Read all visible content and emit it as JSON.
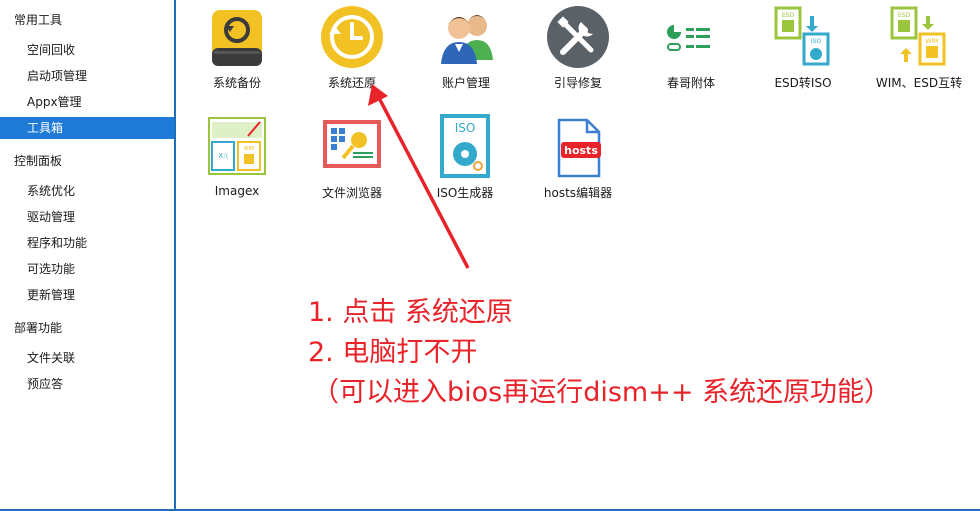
{
  "sidebar": {
    "groups": [
      {
        "title": "常用工具",
        "items": [
          "空间回收",
          "启动项管理",
          "Appx管理",
          "工具箱"
        ]
      },
      {
        "title": "控制面板",
        "items": [
          "系统优化",
          "驱动管理",
          "程序和功能",
          "可选功能",
          "更新管理"
        ]
      },
      {
        "title": "部署功能",
        "items": [
          "文件关联",
          "预应答"
        ]
      }
    ],
    "selected_item": "工具箱"
  },
  "tools": [
    {
      "label": "系统备份",
      "icon": "backup-drive-icon"
    },
    {
      "label": "系统还原",
      "icon": "restore-clock-icon"
    },
    {
      "label": "账户管理",
      "icon": "users-icon"
    },
    {
      "label": "引导修复",
      "icon": "repair-tools-icon"
    },
    {
      "label": "春哥附体",
      "icon": "toggle-list-icon"
    },
    {
      "label": "ESD转ISO",
      "icon": "esd-to-iso-icon"
    },
    {
      "label": "WIM、ESD互转",
      "icon": "wim-esd-convert-icon"
    },
    {
      "label": "Imagex",
      "icon": "imagex-icon"
    },
    {
      "label": "文件浏览器",
      "icon": "file-browser-icon"
    },
    {
      "label": "ISO生成器",
      "icon": "iso-generator-icon"
    },
    {
      "label": "hosts编辑器",
      "icon": "hosts-editor-icon"
    }
  ],
  "icon_text": {
    "esd": "ESD",
    "iso": "ISO",
    "wim": "WIM",
    "hosts": "hosts"
  },
  "annotation": {
    "line1": "1.  点击 系统还原",
    "line2": "2.  电脑打不开",
    "line3": "（可以进入bios再运行dism++ 系统还原功能）"
  },
  "colors": {
    "accent": "#1e7ad6",
    "annotation": "#e8232a"
  }
}
